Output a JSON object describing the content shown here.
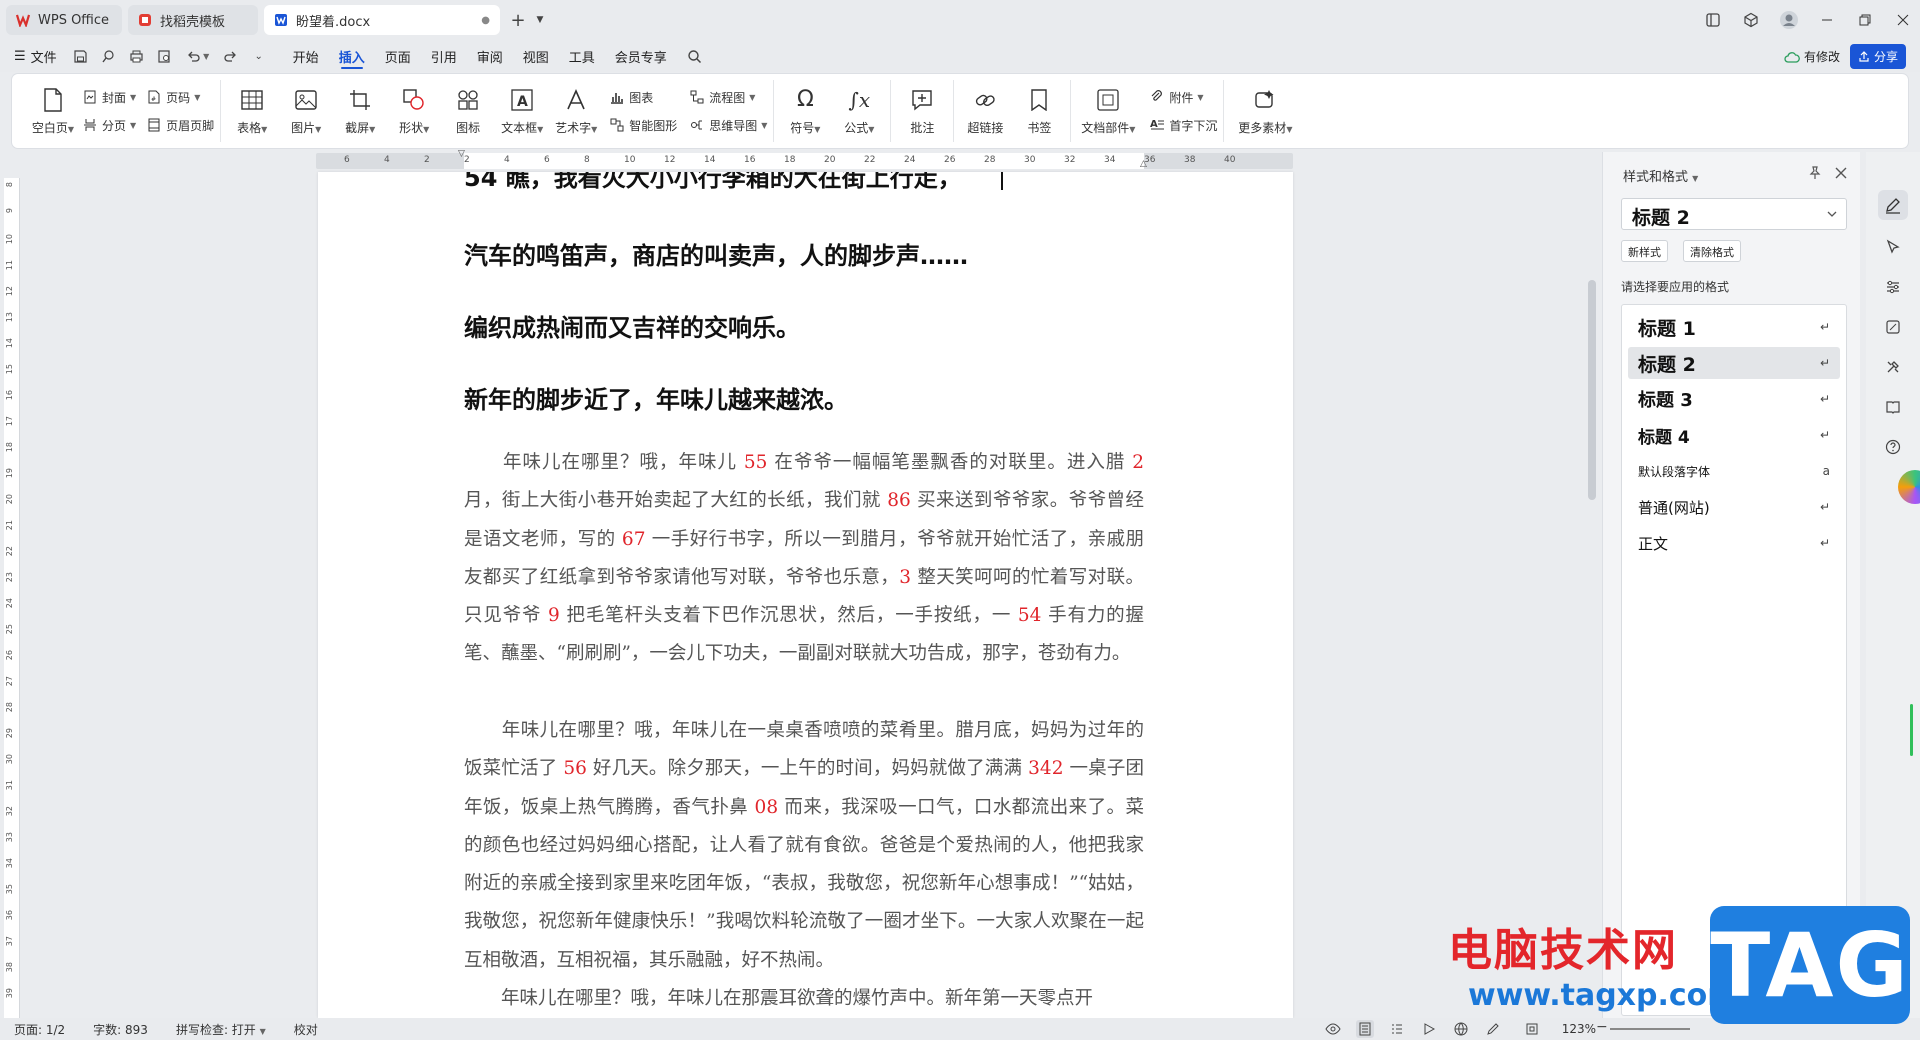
{
  "tabs": [
    {
      "label": "WPS Office",
      "icon": "wps-logo-icon",
      "color": "#d9302c"
    },
    {
      "label": "找稻壳模板",
      "icon": "docer-icon",
      "color": "#e23d34"
    },
    {
      "label": "盼望着.docx",
      "icon": "word-doc-icon",
      "color": "#1a55d6"
    }
  ],
  "menu": {
    "file": "文件",
    "items": [
      "开始",
      "插入",
      "页面",
      "引用",
      "审阅",
      "视图",
      "工具",
      "会员专享"
    ],
    "active": "插入",
    "changes": "有修改",
    "share": "分享"
  },
  "ribbon": {
    "blank_page": "空白页",
    "cover": "封面",
    "page_break": "分页",
    "page_number": "页码",
    "header_footer": "页眉页脚",
    "table": "表格",
    "picture": "图片",
    "screenshot": "截屏",
    "shape": "形状",
    "icon": "图标",
    "textbox": "文本框",
    "wordart": "艺术字",
    "chart": "图表",
    "smart_graphic": "智能图形",
    "flowchart": "流程图",
    "mindmap": "思维导图",
    "symbol": "符号",
    "formula": "公式",
    "comment": "批注",
    "hyperlink": "超链接",
    "bookmark": "书签",
    "doc_parts": "文档部件",
    "attachment": "附件",
    "dropcap": "首字下沉",
    "more": "更多素材"
  },
  "ruler_ticks": [
    "6",
    "4",
    "2",
    "2",
    "4",
    "6",
    "8",
    "10",
    "12",
    "14",
    "16",
    "18",
    "20",
    "22",
    "24",
    "26",
    "28",
    "30",
    "32",
    "34",
    "36",
    "38",
    "40"
  ],
  "vruler_ticks": [
    "8",
    "9",
    "10",
    "11",
    "12",
    "13",
    "14",
    "15",
    "16",
    "17",
    "18",
    "19",
    "20",
    "21",
    "22",
    "23",
    "24",
    "25",
    "26",
    "27",
    "28",
    "29",
    "30",
    "31",
    "32",
    "33",
    "34",
    "35",
    "36",
    "37",
    "38",
    "39"
  ],
  "document": {
    "headings": [
      "54 瞧，我看火大小小行李箱的大在街上行走，",
      "汽车的鸣笛声，商店的叫卖声，人的脚步声……",
      "编织成热闹而又吉祥的交响乐。",
      "新年的脚步近了，年味儿越来越浓。"
    ],
    "para1": [
      {
        "t": "　　年味儿在哪里？哦，年味儿 "
      },
      {
        "t": "55",
        "red": true
      },
      {
        "t": " 在爷爷一幅幅笔墨飘香的对联里。进入腊 "
      },
      {
        "t": "2",
        "red": true
      },
      {
        "t": " 月，街上大街小巷开始卖起了大红的长纸，我们就 "
      },
      {
        "t": "86",
        "red": true
      },
      {
        "t": " 买来送到爷爷家。爷爷曾经是语文老师，写的 "
      },
      {
        "t": "67",
        "red": true
      },
      {
        "t": " 一手好行书字，所以一到腊月，爷爷就开始忙活了，亲戚朋友都买了红纸拿到爷爷家请他写对联，爷爷也乐意，"
      },
      {
        "t": "3",
        "red": true
      },
      {
        "t": " 整天笑呵呵的忙着写对联。只见爷爷 "
      },
      {
        "t": "9",
        "red": true
      },
      {
        "t": " 把毛笔杆头支着下巴作沉思状，然后，一手按纸，一 "
      },
      {
        "t": "54",
        "red": true
      },
      {
        "t": " 手有力的握笔、蘸墨、“刷刷刷”，一会儿下功夫，一副副对联就大功告成，那字，苍劲有力。"
      }
    ],
    "para2": [
      {
        "t": "　　年味儿在哪里？哦，年味儿在一桌桌香喷喷的菜肴里。腊月底，妈妈为过年的饭菜忙活了 "
      },
      {
        "t": "56",
        "red": true
      },
      {
        "t": " 好几天。除夕那天，一上午的时间，妈妈就做了满满 "
      },
      {
        "t": "342",
        "red": true
      },
      {
        "t": " 一桌子团年饭，饭桌上热气腾腾，香气扑鼻 "
      },
      {
        "t": "08",
        "red": true
      },
      {
        "t": " 而来，我深吸一口气，口水都流出来了。菜的颜色也经过妈妈细心搭配，让人看了就有食欲。爸爸是个爱热闹的人，他把我家附近的亲戚全接到家里来吃团年饭，“表叔，我敬您，祝您新年心想事成！”“姑姑，我敬您，祝您新年健康快乐！”我喝饮料轮流敬了一圈才坐下。一大家人欢聚在一起互相敬酒，互相祝福，其乐融融，好不热闹。"
      }
    ],
    "para3": "　　年味儿在哪里？哦，年味儿在那震耳欲聋的爆竹声中。新年第一天零点开"
  },
  "pane": {
    "title": "样式和格式",
    "current": "标题 2",
    "new_style": "新样式",
    "clear_format": "清除格式",
    "prompt": "请选择要应用的格式",
    "styles": [
      {
        "label": "标题 1",
        "size": "19px",
        "bold": true,
        "mark": "↵"
      },
      {
        "label": "标题 2",
        "size": "19px",
        "bold": true,
        "mark": "↵",
        "selected": true
      },
      {
        "label": "标题 3",
        "size": "18px",
        "bold": true,
        "mark": "↵"
      },
      {
        "label": "标题 4",
        "size": "17px",
        "bold": true,
        "mark": "↵"
      },
      {
        "label": "默认段落字体",
        "size": "12px",
        "bold": false,
        "mark": "a"
      },
      {
        "label": "普通(网站)",
        "size": "15px",
        "bold": false,
        "mark": "↵"
      },
      {
        "label": "正文",
        "size": "15px",
        "bold": false,
        "mark": "↵"
      }
    ]
  },
  "status": {
    "page": "页面: 1/2",
    "words": "字数: 893",
    "spell": "拼写检查: 打开",
    "proof": "校对",
    "zoom": "123%"
  },
  "watermark": {
    "cn": "电脑技术网",
    "url": "www.tagxp.com",
    "tag": "TAG"
  }
}
